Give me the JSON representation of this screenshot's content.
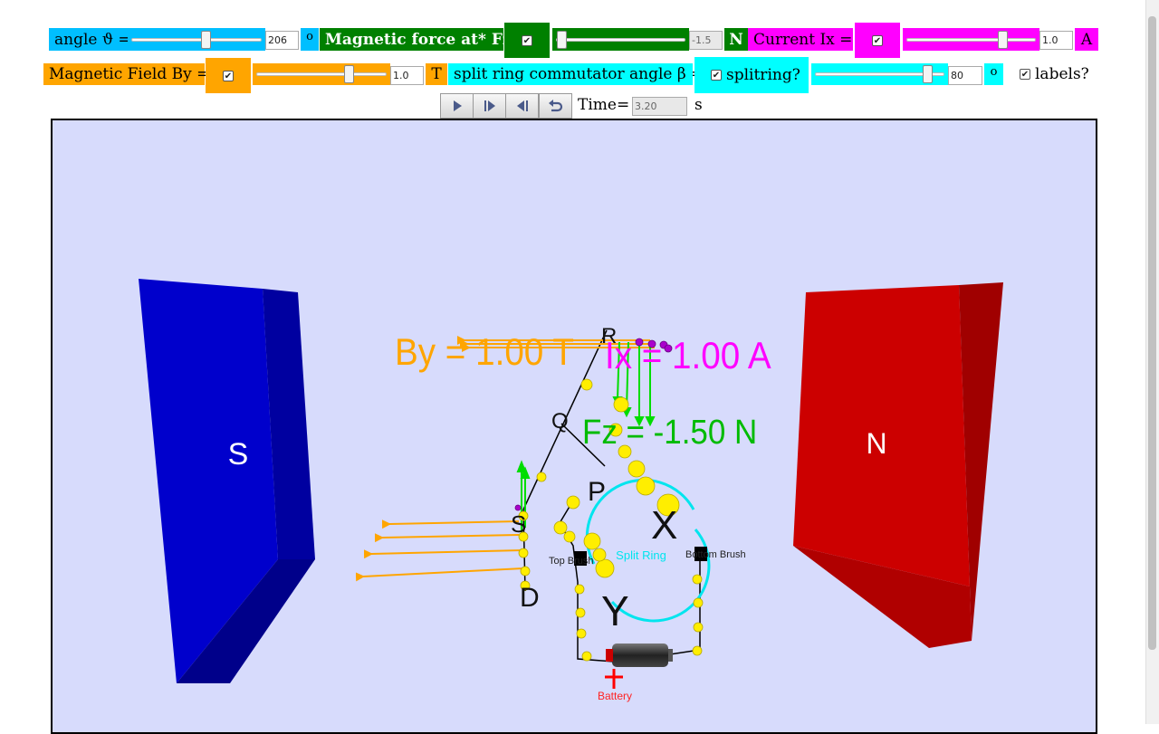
{
  "controls": {
    "angle": {
      "label": "angle ϑ =",
      "value": "206",
      "unit": "o",
      "fraction": 0.57
    },
    "force": {
      "label": "Magnetic force at* Fz =",
      "checked": true,
      "value": "-1.5",
      "unit": "N",
      "fraction": 0.02
    },
    "current": {
      "label": "Current Ix =",
      "checked": true,
      "value": "1.0",
      "unit": "A",
      "fraction": 0.75
    },
    "field": {
      "label": "Magnetic Field By =",
      "checked": true,
      "value": "1.0",
      "unit": "T",
      "fraction": 0.72
    },
    "commutator": {
      "label": "split ring commutator angle β =",
      "check_label": "splitring?",
      "checked": true,
      "value": "80",
      "unit": "o",
      "fraction": 0.88
    },
    "labels": {
      "label": "labels?",
      "checked": true
    }
  },
  "playback": {
    "play_icon": "play-icon",
    "step_forward_icon": "step-forward-icon",
    "step_back_icon": "step-back-icon",
    "reset_icon": "reset-icon",
    "time_label": "Time=",
    "time_value": "3.20",
    "time_unit": "s"
  },
  "scene": {
    "magnet_left": "S",
    "magnet_right": "N",
    "by_label": "By = 1.00 T",
    "ix_label": "Ix = 1.00 A",
    "fz_label": "Fz = -1.50 N",
    "point_r": "R",
    "point_q": "Q",
    "point_p": "P",
    "point_s": "S",
    "point_d": "D",
    "axis_x": "X",
    "axis_y": "Y",
    "top_brush": "Top Brush",
    "bottom_brush": "Bottom Brush",
    "split_ring": "Split Ring",
    "battery": "Battery"
  },
  "colors": {
    "cyan": "#00bfff",
    "green": "#008000",
    "magenta": "#ff00ff",
    "orange": "#ffa500",
    "aqua": "#00ffff",
    "magnet_s": "#0000cc",
    "magnet_n": "#cc0000",
    "background": "#d7dbfc"
  }
}
